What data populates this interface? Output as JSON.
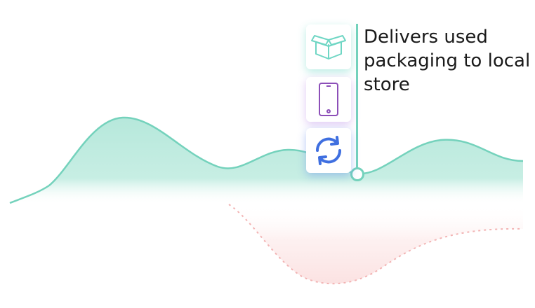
{
  "caption": {
    "text": "Delivers used packaging to local store"
  },
  "icons": [
    {
      "name": "box-icon",
      "color": "#6fd6c4"
    },
    {
      "name": "phone-icon",
      "color": "#8c4fb8"
    },
    {
      "name": "sync-icon",
      "color": "#3f6fe0"
    }
  ],
  "colors": {
    "positive_fill": "#b6e8db",
    "positive_line": "#74d2bc",
    "negative_fill": "#fbe4e4",
    "negative_line": "#f2b3b3"
  }
}
